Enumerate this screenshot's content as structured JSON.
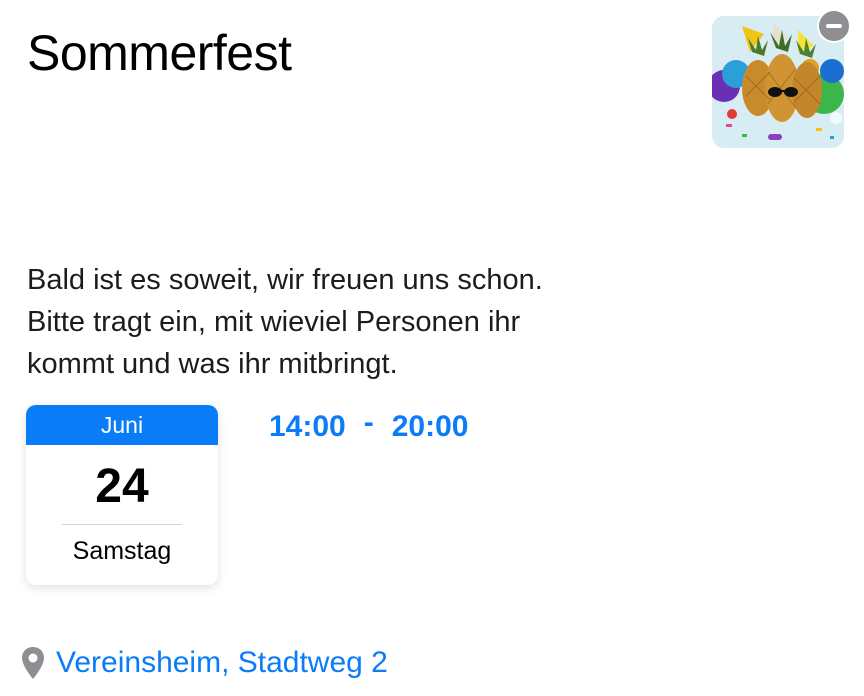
{
  "event": {
    "title": "Sommerfest",
    "description": "Bald ist es soweit, wir freuen uns schon.\nBitte tragt ein, mit wieviel Personen ihr\nkommt und was ihr mitbringt.",
    "image_icon": "party-pineapples-image",
    "remove_icon": "minus-circle-icon"
  },
  "date": {
    "month": "Juni",
    "day": "24",
    "weekday": "Samstag"
  },
  "time": {
    "start": "14:00",
    "separator": "-",
    "end": "20:00"
  },
  "location": {
    "icon": "map-pin-icon",
    "label": "Vereinsheim, Stadtweg 2"
  },
  "colors": {
    "accent": "#0a7cf7",
    "remove_button": "#8e8e93"
  }
}
